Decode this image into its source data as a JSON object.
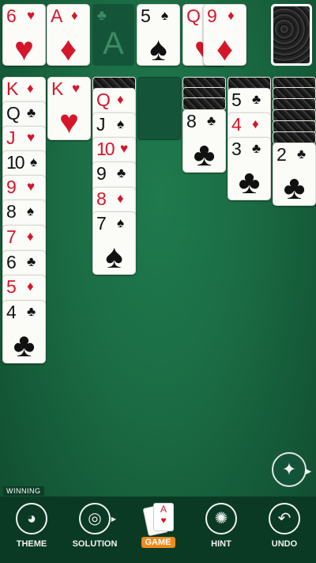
{
  "suits": {
    "spade": "♠",
    "heart": "♥",
    "diamond": "♦",
    "club": "♣"
  },
  "colors": {
    "felt": "#1b6c44",
    "red_suit": "#d5162a",
    "black_suit": "#111111",
    "game_accent": "#f08a1c"
  },
  "top_row": {
    "waste": [
      {
        "rank": "6",
        "suit": "♥",
        "color": "red"
      },
      {
        "rank": "A",
        "suit": "♦",
        "color": "red"
      }
    ],
    "foundation_placeholder": {
      "rank": "A",
      "suit": "♣"
    },
    "foundation": [
      {
        "rank": "5",
        "suit": "♠",
        "color": "black"
      },
      {
        "rank": "Q",
        "suit": "♥",
        "color": "red"
      },
      {
        "rank": "9",
        "suit": "♦",
        "color": "red"
      }
    ]
  },
  "tableau": {
    "col1": [
      {
        "rank": "K",
        "suit": "♦",
        "color": "red"
      },
      {
        "rank": "Q",
        "suit": "♣",
        "color": "black"
      },
      {
        "rank": "J",
        "suit": "♥",
        "color": "red"
      },
      {
        "rank": "10",
        "suit": "♠",
        "color": "black"
      },
      {
        "rank": "9",
        "suit": "♥",
        "color": "red"
      },
      {
        "rank": "8",
        "suit": "♠",
        "color": "black"
      },
      {
        "rank": "7",
        "suit": "♦",
        "color": "red"
      },
      {
        "rank": "6",
        "suit": "♣",
        "color": "black"
      },
      {
        "rank": "5",
        "suit": "♦",
        "color": "red"
      },
      {
        "rank": "4",
        "suit": "♣",
        "color": "black"
      }
    ],
    "col2": [
      {
        "rank": "K",
        "suit": "♥",
        "color": "red"
      }
    ],
    "col3": [
      {
        "rank": "Q",
        "suit": "♦",
        "color": "red"
      },
      {
        "rank": "J",
        "suit": "♠",
        "color": "black"
      },
      {
        "rank": "10",
        "suit": "♥",
        "color": "red"
      },
      {
        "rank": "9",
        "suit": "♣",
        "color": "black"
      },
      {
        "rank": "8",
        "suit": "♦",
        "color": "red"
      },
      {
        "rank": "7",
        "suit": "♠",
        "color": "black"
      }
    ],
    "col5": [
      {
        "rank": "8",
        "suit": "♣",
        "color": "black"
      }
    ],
    "col6": [
      {
        "rank": "5",
        "suit": "♣",
        "color": "black"
      },
      {
        "rank": "4",
        "suit": "♦",
        "color": "red"
      },
      {
        "rank": "3",
        "suit": "♣",
        "color": "black"
      }
    ],
    "col7": [
      {
        "rank": "2",
        "suit": "♣",
        "color": "black"
      }
    ]
  },
  "status": {
    "winning_label": "WINNING"
  },
  "toolbar": {
    "theme_label": "THEME",
    "solution_label": "SOLUTION",
    "game_label": "GAME",
    "hint_label": "HINT",
    "undo_label": "UNDO",
    "game_mini_rank": "A",
    "game_mini_suit": "♥"
  },
  "icons": {
    "theme": "palette-icon",
    "solution": "crystal-ball-icon",
    "game": "cards-icon",
    "hint": "lightbulb-icon",
    "undo": "undo-arrow-icon",
    "auto": "magic-wand-icon"
  }
}
